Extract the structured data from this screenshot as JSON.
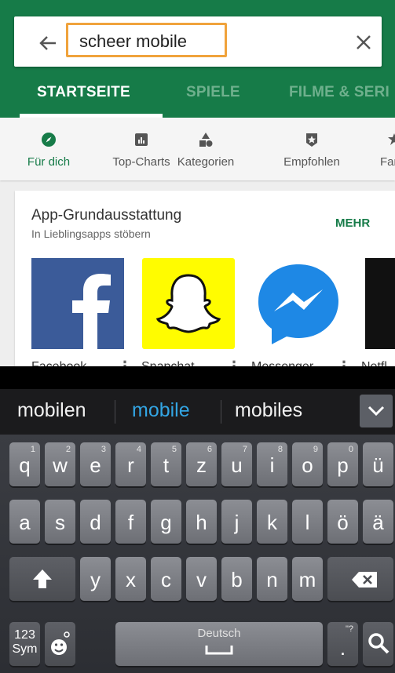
{
  "search": {
    "query": "scheer mobile"
  },
  "tabs": [
    {
      "label": "STARTSEITE"
    },
    {
      "label": "SPIELE"
    },
    {
      "label": "FILME & SERI"
    }
  ],
  "subnav": [
    {
      "label": "Für dich"
    },
    {
      "label": "Top-Charts"
    },
    {
      "label": "Kategorien"
    },
    {
      "label": "Empfohlen"
    },
    {
      "label": "Far"
    }
  ],
  "card": {
    "title": "App-Grundausstattung",
    "subtitle": "In Lieblingsapps stöbern",
    "more": "MEHR",
    "apps": [
      {
        "name": "Facebook"
      },
      {
        "name": "Snapchat"
      },
      {
        "name": "Messenger"
      },
      {
        "name": "Netfl"
      }
    ]
  },
  "suggestions": [
    "mobilen",
    "mobile",
    "mobiles"
  ],
  "keyboard": {
    "row1": [
      {
        "k": "q",
        "h": "1"
      },
      {
        "k": "w",
        "h": "2"
      },
      {
        "k": "e",
        "h": "3"
      },
      {
        "k": "r",
        "h": "4"
      },
      {
        "k": "t",
        "h": "5"
      },
      {
        "k": "z",
        "h": "6"
      },
      {
        "k": "u",
        "h": "7"
      },
      {
        "k": "i",
        "h": "8"
      },
      {
        "k": "o",
        "h": "9"
      },
      {
        "k": "p",
        "h": "0"
      },
      {
        "k": "ü",
        "h": ""
      }
    ],
    "row2": [
      "a",
      "s",
      "d",
      "f",
      "g",
      "h",
      "j",
      "k",
      "l",
      "ö",
      "ä"
    ],
    "row3": [
      "y",
      "x",
      "c",
      "v",
      "b",
      "n",
      "m"
    ],
    "sym_label": "123\nSym",
    "space_label": "Deutsch",
    "period_label": ".",
    "period_hint": "\"?"
  },
  "colors": {
    "brand_green": "#167b48",
    "highlight": "#f0a33c",
    "suggest_blue": "#33a5e3"
  }
}
